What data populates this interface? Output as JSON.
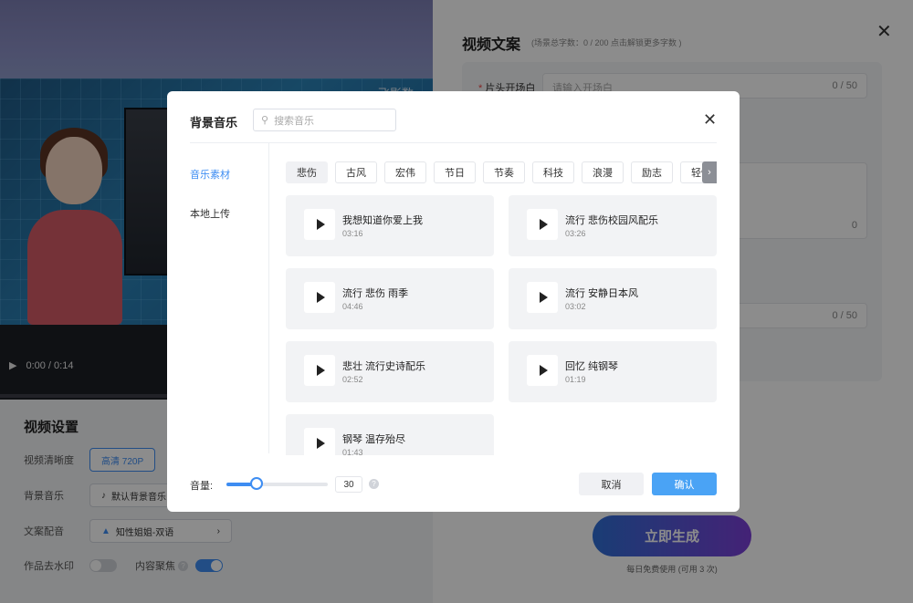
{
  "video": {
    "brand": "飞影数",
    "time": "0:00 / 0:14",
    "progress": 0
  },
  "settings": {
    "title": "视频设置",
    "resolution_label": "视频清晰度",
    "resolution_value": "高清 720P",
    "music_label": "背景音乐",
    "music_value": "默认背景音乐",
    "voice_label": "文案配音",
    "voice_value": "知性姐姐-双语",
    "watermark_label": "作品去水印",
    "watermark_on": false,
    "focus_label": "内容聚焦",
    "focus_on": true
  },
  "copy_panel": {
    "title": "视频文案",
    "subtitle": "(场景总字数：0 / 200   点击解锁更多字数 )",
    "opening_label": "片头开场白",
    "opening_placeholder": "请输入开场白",
    "opening_count": "0 / 50",
    "field2_count": "0",
    "field3_count": "0 / 50",
    "generate_label": "立即生成",
    "generate_hint": "每日免费使用 (可用 3 次)"
  },
  "modal": {
    "title": "背景音乐",
    "search_placeholder": "搜索音乐",
    "nav": [
      "音乐素材",
      "本地上传"
    ],
    "nav_active": 0,
    "tags": [
      "悲伤",
      "古风",
      "宏伟",
      "节日",
      "节奏",
      "科技",
      "浪漫",
      "励志",
      "轻快"
    ],
    "tag_selected": 0,
    "tracks": [
      {
        "name": "我想知道你爱上我",
        "duration": "03:16"
      },
      {
        "name": "流行 悲伤校园风配乐",
        "duration": "03:26"
      },
      {
        "name": "流行 悲伤 雨季",
        "duration": "04:46"
      },
      {
        "name": "流行 安静日本风",
        "duration": "03:02"
      },
      {
        "name": "悲壮 流行史诗配乐",
        "duration": "02:52"
      },
      {
        "name": "回忆 纯钢琴",
        "duration": "01:19"
      },
      {
        "name": "钢琴 温存殆尽",
        "duration": "01:43"
      }
    ],
    "volume_label": "音量:",
    "volume": 30,
    "volume_max": 100,
    "cancel_label": "取消",
    "confirm_label": "确认"
  },
  "colors": {
    "accent": "#3e8df2",
    "confirm": "#4aa3f5"
  }
}
